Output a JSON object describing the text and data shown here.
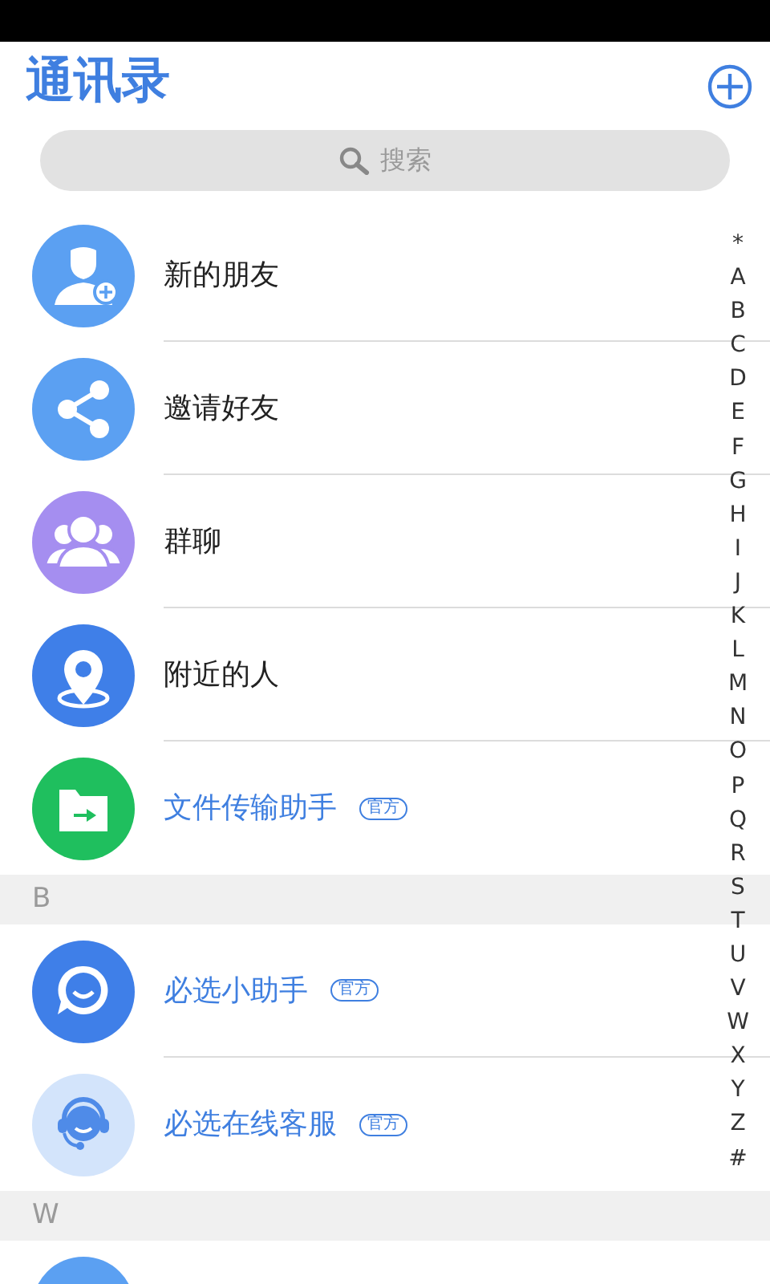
{
  "header": {
    "title": "通讯录"
  },
  "search": {
    "placeholder": "搜索"
  },
  "sections": [
    {
      "items": [
        {
          "kind": "new-friend",
          "name": "新的朋友",
          "official": false
        },
        {
          "kind": "share",
          "name": "邀请好友",
          "official": false
        },
        {
          "kind": "group",
          "name": "群聊",
          "official": false
        },
        {
          "kind": "location",
          "name": "附近的人",
          "official": false
        },
        {
          "kind": "folder",
          "name": "文件传输助手",
          "official": true,
          "badge": "官方"
        }
      ]
    },
    {
      "letter": "B",
      "items": [
        {
          "kind": "chat",
          "name": "必选小助手",
          "official": true,
          "badge": "官方"
        },
        {
          "kind": "headset",
          "name": "必选在线客服",
          "official": true,
          "badge": "官方"
        }
      ]
    },
    {
      "letter": "W",
      "items": [
        {
          "kind": "blank"
        }
      ]
    }
  ],
  "index": [
    "*",
    "A",
    "B",
    "C",
    "D",
    "E",
    "F",
    "G",
    "H",
    "I",
    "J",
    "K",
    "L",
    "M",
    "N",
    "O",
    "P",
    "Q",
    "R",
    "S",
    "T",
    "U",
    "V",
    "W",
    "X",
    "Y",
    "Z",
    "#"
  ]
}
